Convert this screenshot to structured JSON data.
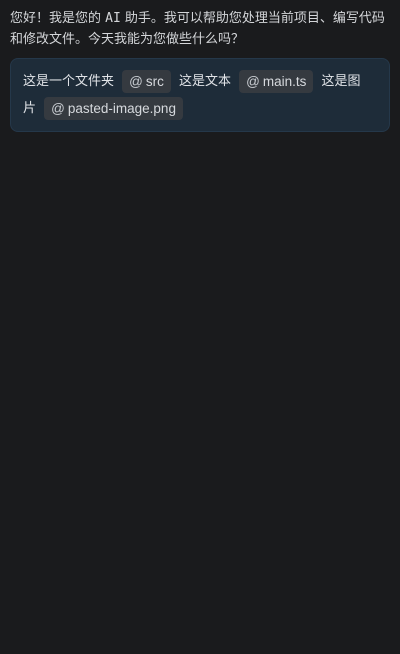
{
  "assistant_message": {
    "part1": "您好！我是您的 ",
    "ai": "AI",
    "part2": " 助手。我可以帮助您处理当前项目、编写代码和修改文件。今天我能为您做些什么吗？"
  },
  "user_message": {
    "seg1": "这是一个文件夹",
    "chip1": "src",
    "seg2": "这是文本",
    "chip2": "main.ts",
    "seg3": "这是图片",
    "chip3": "pasted-image.png",
    "mention_symbol": "@"
  },
  "icons": {
    "mention": "at-icon"
  },
  "colors": {
    "background": "#1a1b1d",
    "bubble": "#1e2c39",
    "chip": "#353a40"
  }
}
